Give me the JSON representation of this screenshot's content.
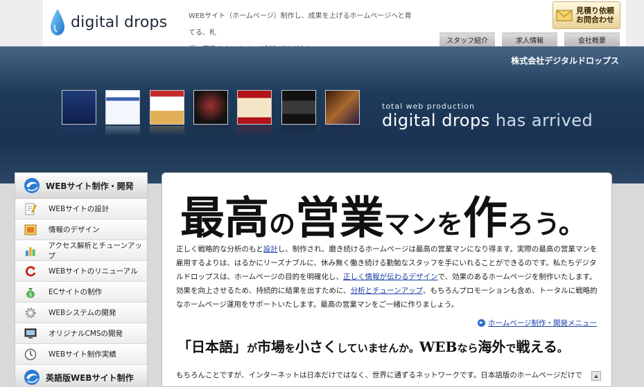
{
  "header": {
    "logo_text": "digital drops",
    "tagline_line1": "WEBサイト（ホームページ）制作し、成果を上げるホームページへと育てる、札",
    "tagline_line2": "幌・東京のホームページ制作プロダクション。",
    "quote_button": {
      "line1": "見積り依頼",
      "line2": "お問合わせ"
    },
    "nav": [
      {
        "label": "スタッフ紹介"
      },
      {
        "label": "求人情報"
      },
      {
        "label": "会社概要"
      }
    ]
  },
  "banner": {
    "company": "株式会社デジタルドロップス",
    "small_line": "total web production",
    "big_line_main": "digital drops",
    "big_line_tail": " has arrived"
  },
  "sidebar": {
    "section1_title": "WEBサイト制作・開発",
    "items": [
      {
        "label": "WEBサイトの設計"
      },
      {
        "label": "情報のデザイン"
      },
      {
        "label": "アクセス解析とチューンアップ"
      },
      {
        "label": "WEBサイトのリニューアル"
      },
      {
        "label": "ECサイトの制作"
      },
      {
        "label": "WEBシステムの開発"
      },
      {
        "label": "オリジナルCMSの開発"
      },
      {
        "label": "WEBサイト制作実績"
      }
    ],
    "section2_title": "英語版WEBサイト制作"
  },
  "main": {
    "headline": {
      "p1": "最高",
      "p2": "の",
      "p3": "営業",
      "p4": "マン",
      "p5": "を",
      "p6": "作",
      "p7": "ろう。"
    },
    "body": {
      "t1": "正しく戦略的な分析のもと",
      "link1": "設計",
      "t2": "し、制作され、磨き続けるホームページは最高の営業マンになり得ます。実際の最高の営業マンを雇用するよりは、はるかにリーズナブルに、休み無く働き続ける勤勉なスタッフを手にいれることができるのです。私たちデジタルドロップスは、ホームページの目的を明確化し、",
      "link2": "正しく情報が伝わるデザイン",
      "t3": "で、効果のあるホームページを制作いたします。効果を向上させるため、持続的に結果を出すために、",
      "link3": "分析とチューンアップ",
      "t4": "、もちろんプロモーションも含め、トータルに戦略的なホームページ運用をサポートいたします。最高の営業マンをご一緒に作りましょう。"
    },
    "more_link": "ホームページ制作・開発メニュー",
    "headline2": {
      "p1": "「日本語」",
      "p2": "が",
      "p3": "市場",
      "p4": "を",
      "p5": "小さく",
      "p6": "していませんか。",
      "p7": "WEB",
      "p8": "なら",
      "p9": "海外",
      "p10": "で",
      "p11": "戦える",
      "p12": "。"
    },
    "body2": "もちろんことですが、インターネットは日本だけではなく、世界に通ずるネットワークです。日本語版のホームページだけで"
  }
}
